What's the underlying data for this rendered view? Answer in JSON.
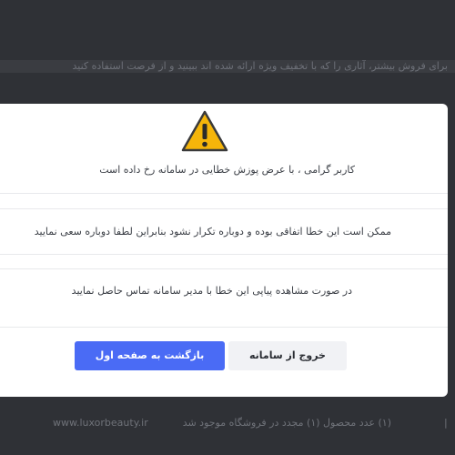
{
  "background": {
    "top_strip_text": "برای فروش بیشتر، آثاری را که با تخفیف ویژه ارائه شده اند ببینید و از فرصت استفاده کنید",
    "footer_site": "www.luxorbeauty.ir",
    "footer_message": "(۱) عدد محصول (۱) مجدد در فروشگاه موجود شد",
    "footer_pipe": "|"
  },
  "modal": {
    "icon": "warning-triangle-icon",
    "title_text": "کاربر گرامی ، با عرض پوزش خطایی در سامانه رخ داده است",
    "message_retry": "ممکن است این خطا اتفاقی بوده و دوباره تکرار نشود بنابراین لطفا دوباره سعی نمایید",
    "message_contact": "در صورت مشاهده پیاپی این خطا با مدیر سامانه تماس حاصل نمایید",
    "buttons": {
      "back_home": "بازگشت به صفحه اول",
      "logout": "خروج از سامانه"
    }
  },
  "colors": {
    "primary": "#4a6bf5",
    "warning": "#f5b50a",
    "overlay": "#2f3136"
  }
}
